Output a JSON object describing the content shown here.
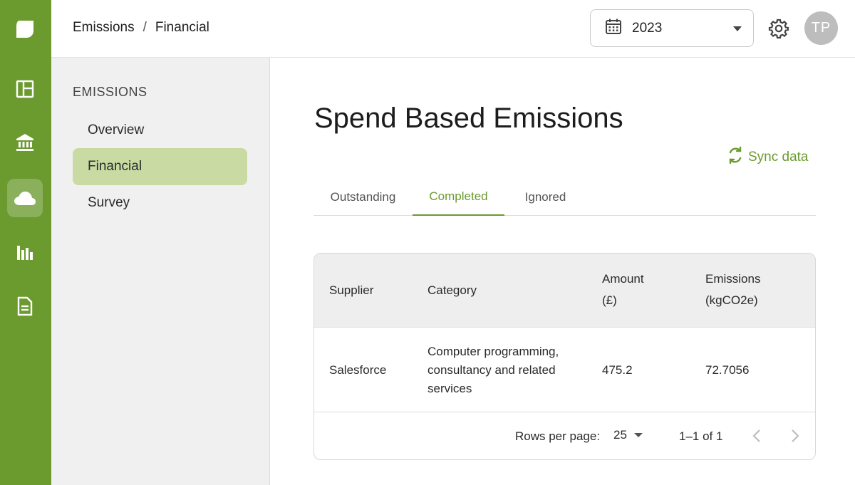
{
  "rail": {
    "items": [
      {
        "icon": "leaf-logo-icon"
      },
      {
        "icon": "dashboard-icon"
      },
      {
        "icon": "bank-icon"
      },
      {
        "icon": "cloud-icon",
        "active": true
      },
      {
        "icon": "bar-chart-icon"
      },
      {
        "icon": "document-icon"
      }
    ]
  },
  "header": {
    "breadcrumb": [
      "Emissions",
      "Financial"
    ],
    "breadcrumb_sep": "/",
    "year": "2023",
    "avatar_initials": "TP"
  },
  "sidenav": {
    "heading": "EMISSIONS",
    "items": [
      {
        "label": "Overview"
      },
      {
        "label": "Financial",
        "active": true
      },
      {
        "label": "Survey"
      }
    ]
  },
  "main": {
    "title": "Spend Based Emissions",
    "sync_label": "Sync data",
    "tabs": [
      {
        "label": "Outstanding"
      },
      {
        "label": "Completed",
        "active": true
      },
      {
        "label": "Ignored"
      }
    ],
    "table": {
      "columns": [
        {
          "line1": "Supplier",
          "line2": ""
        },
        {
          "line1": "Category",
          "line2": ""
        },
        {
          "line1": "Amount",
          "line2": "(£)"
        },
        {
          "line1": "Emissions",
          "line2": "(kgCO2e)"
        }
      ],
      "rows": [
        {
          "supplier": "Salesforce",
          "category_lines": [
            "Computer programming,",
            "consultancy and related",
            "services"
          ],
          "amount": "475.2",
          "emissions": "72.7056"
        }
      ]
    },
    "pagination": {
      "rows_per_page_label": "Rows per page:",
      "rows_per_page": "25",
      "range": "1–1 of 1"
    }
  },
  "colors": {
    "brand": "#6b9a2e",
    "active_nav": "#c9dba3"
  }
}
